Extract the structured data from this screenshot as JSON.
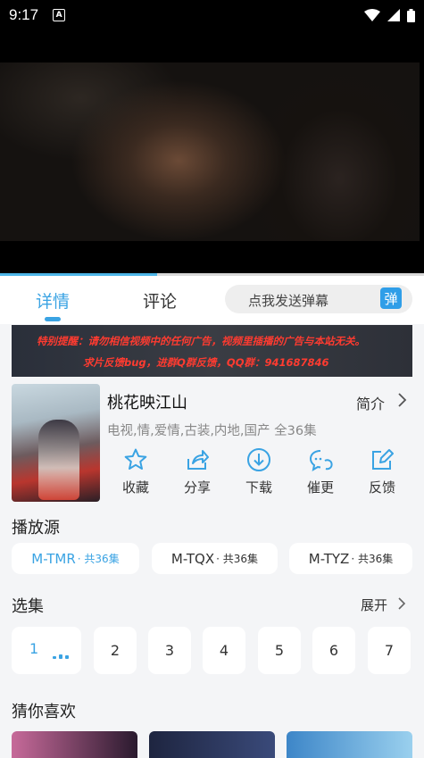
{
  "status": {
    "time": "9:17",
    "a_icon": "A"
  },
  "player": {
    "progress": 0.37
  },
  "tabs": {
    "detail": "详情",
    "comment": "评论"
  },
  "danmu": {
    "placeholder": "点我发送弹幕",
    "button": "弹"
  },
  "banner": {
    "line1": "特别提醒：请勿相信视频中的任何广告，视频里插播的广告与本站无关。",
    "line2": "求片反馈bug，进群Q群反馈，QQ群：941687846"
  },
  "show": {
    "title": "桃花映江山",
    "intro_label": "简介",
    "tags": "电视,情,爱情,古装,内地,国产 全36集"
  },
  "actions": [
    {
      "label": "收藏",
      "icon": "star-icon"
    },
    {
      "label": "分享",
      "icon": "share-icon"
    },
    {
      "label": "下载",
      "icon": "download-icon"
    },
    {
      "label": "催更",
      "icon": "urge-icon"
    },
    {
      "label": "反馈",
      "icon": "feedback-icon"
    }
  ],
  "sources": {
    "title": "播放源",
    "items": [
      {
        "name": "M-TMR",
        "count": "· 共36集"
      },
      {
        "name": "M-TQX",
        "count": "· 共36集"
      },
      {
        "name": "M-TYZ",
        "count": "· 共36集"
      }
    ]
  },
  "episodes": {
    "title": "选集",
    "expand": "展开",
    "items": [
      "1",
      "2",
      "3",
      "4",
      "5",
      "6",
      "7"
    ]
  },
  "recommend": {
    "title": "猜你喜欢"
  },
  "colors": {
    "accent": "#3aa3e3",
    "banner_text": "#ff3b30"
  }
}
